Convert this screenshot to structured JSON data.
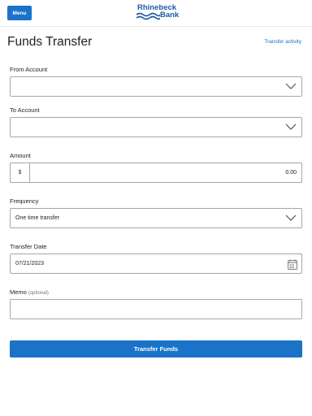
{
  "header": {
    "menu_label": "Menu",
    "logo_line1": "Rhinebeck",
    "logo_line2": "Bank"
  },
  "page": {
    "title": "Funds Transfer",
    "transfer_activity_link": "Transfer activity"
  },
  "form": {
    "from_account": {
      "label": "From Account",
      "value": ""
    },
    "to_account": {
      "label": "To Account",
      "value": ""
    },
    "amount": {
      "label": "Amount",
      "currency_symbol": "$",
      "value": "0.00"
    },
    "frequency": {
      "label": "Frequency",
      "value": "One time transfer"
    },
    "transfer_date": {
      "label": "Transfer Date",
      "value": "07/21/2023"
    },
    "memo": {
      "label": "Memo",
      "optional_note": "(optional)",
      "value": ""
    },
    "submit_label": "Transfer Funds"
  },
  "colors": {
    "primary": "#1a73c8",
    "logo": "#1c5aa6",
    "link": "#1a6cc4"
  }
}
